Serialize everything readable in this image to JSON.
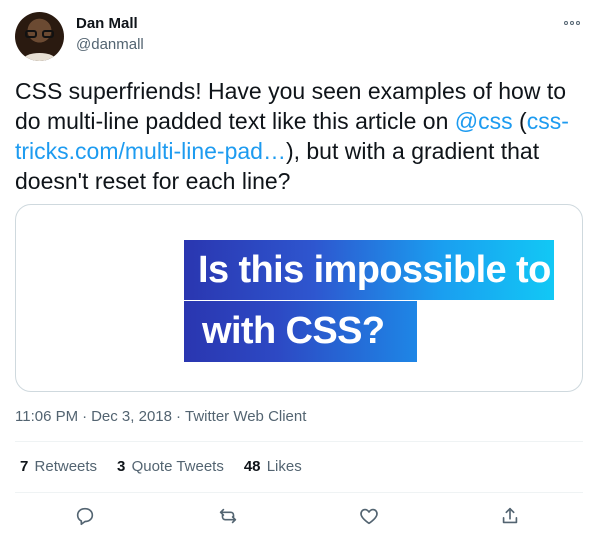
{
  "author": {
    "display_name": "Dan Mall",
    "handle": "@danmall"
  },
  "tweet": {
    "text_part1": "CSS superfriends! Have you seen examples of how to do multi-line padded text like this article on ",
    "mention": "@css",
    "text_part2": " (",
    "link": "css-tricks.com/multi-line-pad…",
    "text_part3": "), but with a gradient that doesn't reset for each line?"
  },
  "media": {
    "headline_line1": "Is this impossible to do",
    "headline_line2": "with CSS?",
    "gradient_start": "#2a36b0",
    "gradient_end": "#12c8f5"
  },
  "meta": {
    "time": "11:06 PM",
    "date": "Dec 3, 2018",
    "client": "Twitter Web Client",
    "separator": "·"
  },
  "stats": {
    "retweets_count": "7",
    "retweets_label": "Retweets",
    "quotes_count": "3",
    "quotes_label": "Quote Tweets",
    "likes_count": "48",
    "likes_label": "Likes"
  },
  "actions": {
    "reply_icon": "reply-icon",
    "retweet_icon": "retweet-icon",
    "like_icon": "heart-icon",
    "share_icon": "share-icon"
  },
  "colors": {
    "link": "#1d9bf0",
    "secondary_text": "#536471",
    "primary_text": "#0f1419"
  }
}
